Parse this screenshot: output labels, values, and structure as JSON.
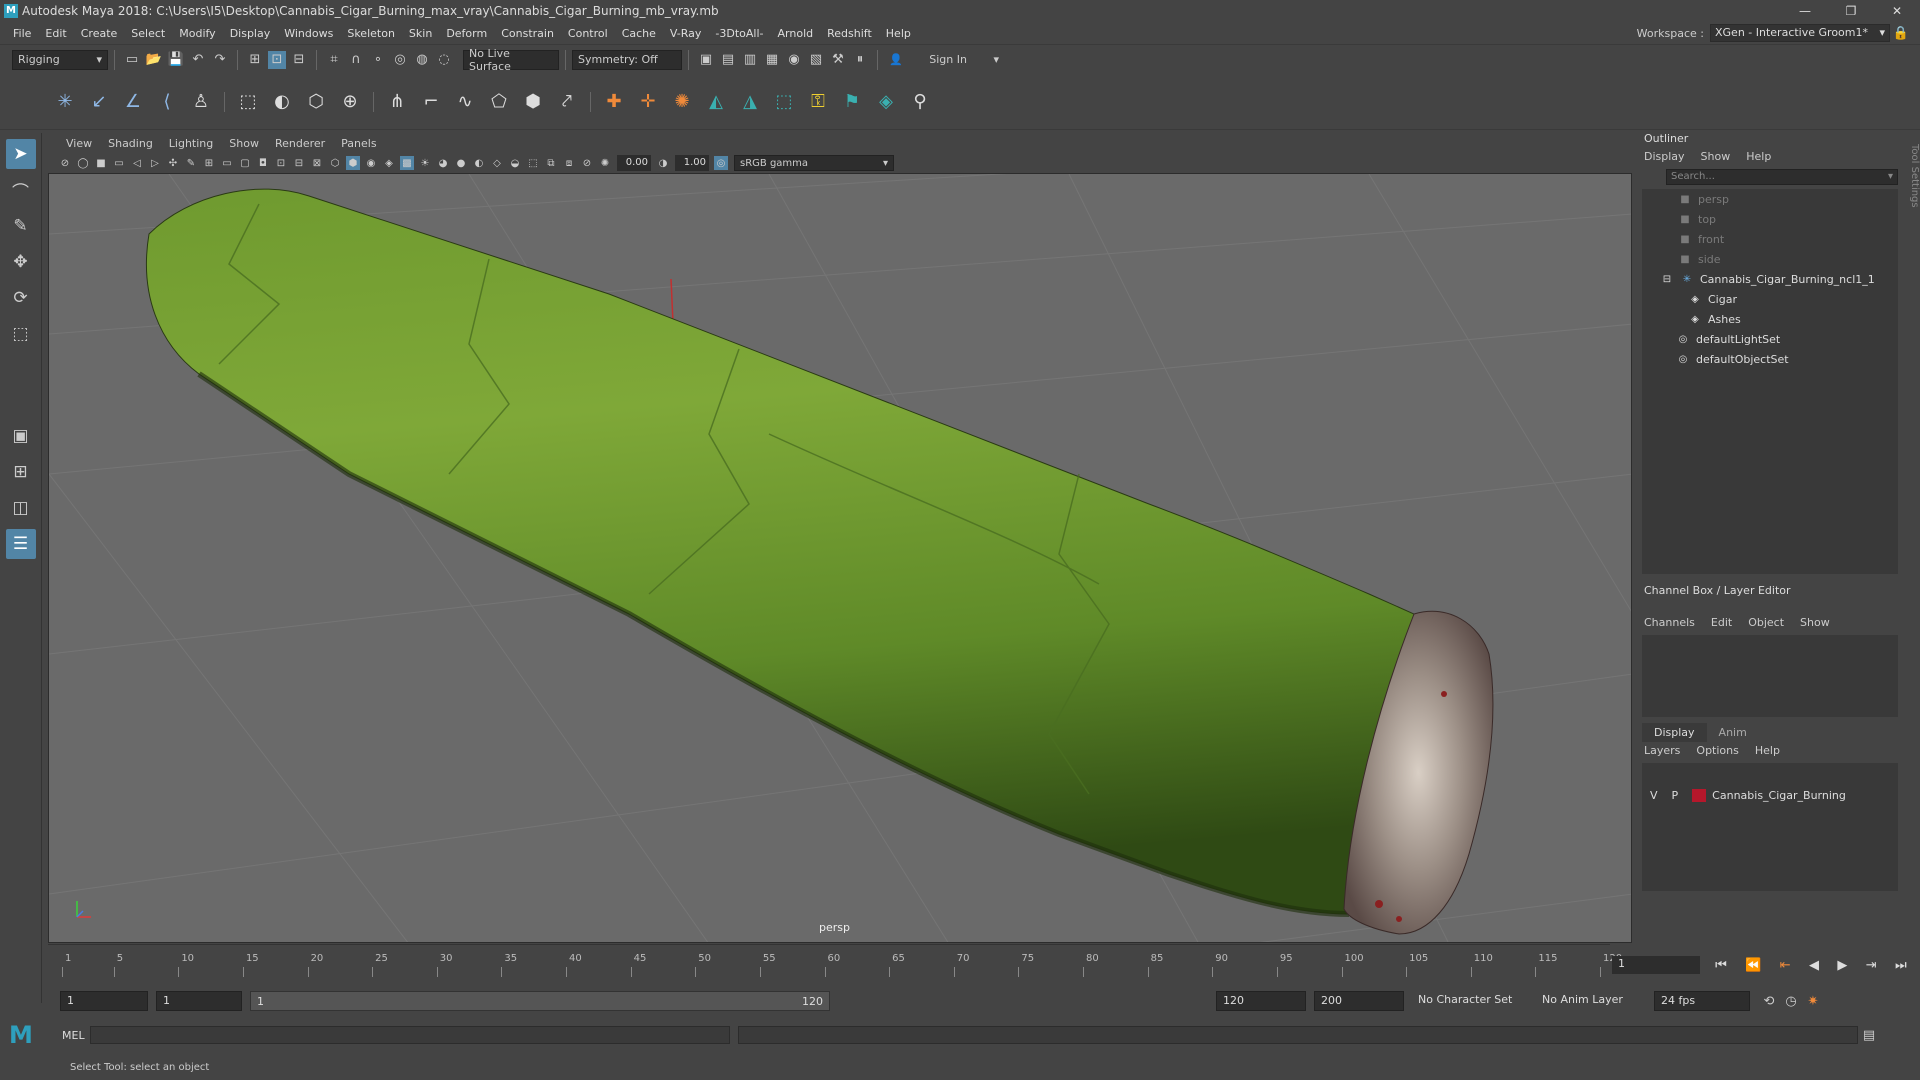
{
  "app": {
    "title": "Autodesk Maya 2018: C:\\Users\\I5\\Desktop\\Cannabis_Cigar_Burning_max_vray\\Cannabis_Cigar_Burning_mb_vray.mb",
    "logo": "M"
  },
  "window_controls": [
    "—",
    "❐",
    "✕"
  ],
  "menus": [
    "File",
    "Edit",
    "Create",
    "Select",
    "Modify",
    "Display",
    "Windows",
    "Skeleton",
    "Skin",
    "Deform",
    "Constrain",
    "Control",
    "Cache",
    "V-Ray",
    "-3DtoAll-",
    "Arnold",
    "Redshift",
    "Help"
  ],
  "workspace": {
    "label": "Workspace :",
    "value": "XGen - Interactive Groom1*"
  },
  "status": {
    "mode": "Rigging",
    "live_surface": "No Live Surface",
    "symmetry": "Symmetry: Off",
    "sign_in": "Sign In"
  },
  "viewport": {
    "menus": [
      "View",
      "Shading",
      "Lighting",
      "Show",
      "Renderer",
      "Panels"
    ],
    "exposure": "0.00",
    "gamma": "1.00",
    "color_space": "sRGB gamma",
    "camera": "persp"
  },
  "outliner": {
    "title": "Outliner",
    "menus": [
      "Display",
      "Show",
      "Help"
    ],
    "search_placeholder": "Search...",
    "items": [
      {
        "label": "persp",
        "icon": "camera-icon",
        "dim": true,
        "indent": 0
      },
      {
        "label": "top",
        "icon": "camera-icon",
        "dim": true,
        "indent": 0
      },
      {
        "label": "front",
        "icon": "camera-icon",
        "dim": true,
        "indent": 0
      },
      {
        "label": "side",
        "icon": "camera-icon",
        "dim": true,
        "indent": 0
      },
      {
        "label": "Cannabis_Cigar_Burning_ncl1_1",
        "icon": "group-icon",
        "dim": false,
        "indent": 0
      },
      {
        "label": "Cigar",
        "icon": "mesh-icon",
        "dim": false,
        "indent": 1
      },
      {
        "label": "Ashes",
        "icon": "mesh-icon",
        "dim": false,
        "indent": 1
      },
      {
        "label": "defaultLightSet",
        "icon": "set-icon",
        "dim": false,
        "indent": 0
      },
      {
        "label": "defaultObjectSet",
        "icon": "set-icon",
        "dim": false,
        "indent": 0
      }
    ]
  },
  "channel_box": {
    "title": "Channel Box / Layer Editor",
    "menus": [
      "Channels",
      "Edit",
      "Object",
      "Show"
    ]
  },
  "layer_editor": {
    "tabs": [
      "Display",
      "Anim"
    ],
    "menus": [
      "Layers",
      "Options",
      "Help"
    ],
    "layers": [
      {
        "v": "V",
        "p": "P",
        "name": "Cannabis_Cigar_Burning",
        "color": "#b5172b"
      }
    ]
  },
  "tool_settings_label": "Tool Settings",
  "timeline": {
    "ticks": [
      "1",
      "5",
      "10",
      "15",
      "20",
      "25",
      "30",
      "35",
      "40",
      "45",
      "50",
      "55",
      "60",
      "65",
      "70",
      "75",
      "80",
      "85",
      "90",
      "95",
      "100",
      "105",
      "110",
      "115",
      "120"
    ],
    "current_frame": "1"
  },
  "range": {
    "start": "1",
    "playback_start": "1",
    "slider_start": "1",
    "slider_end": "120",
    "playback_end": "120",
    "end": "200",
    "character_set": "No Character Set",
    "anim_layer": "No Anim Layer",
    "fps": "24 fps"
  },
  "command": {
    "lang": "MEL"
  },
  "help_line": "Select Tool: select an object"
}
